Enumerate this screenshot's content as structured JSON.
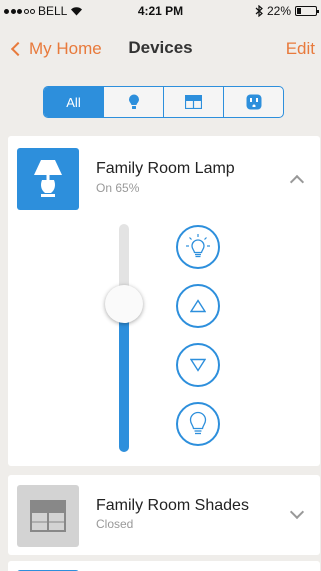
{
  "status_bar": {
    "carrier": "BELL",
    "time": "4:21 PM",
    "battery": "22%",
    "battery_level": 0.22
  },
  "nav": {
    "back_label": "My Home",
    "title": "Devices",
    "edit_label": "Edit"
  },
  "filter": {
    "segments": [
      {
        "label": "All",
        "icon": "all",
        "active": true
      },
      {
        "label": "",
        "icon": "bulb-icon"
      },
      {
        "label": "",
        "icon": "shade-icon"
      },
      {
        "label": "",
        "icon": "outlet-icon"
      }
    ]
  },
  "devices": [
    {
      "name": "Family Room Lamp",
      "status": "On 65%",
      "icon": "lamp-icon",
      "expanded": true,
      "level": 0.65
    },
    {
      "name": "Family Room Shades",
      "status": "Closed",
      "icon": "shades-icon",
      "expanded": false
    }
  ],
  "colors": {
    "accent": "#e87a3c",
    "blue": "#2d8fdc",
    "background": "#efedea"
  }
}
